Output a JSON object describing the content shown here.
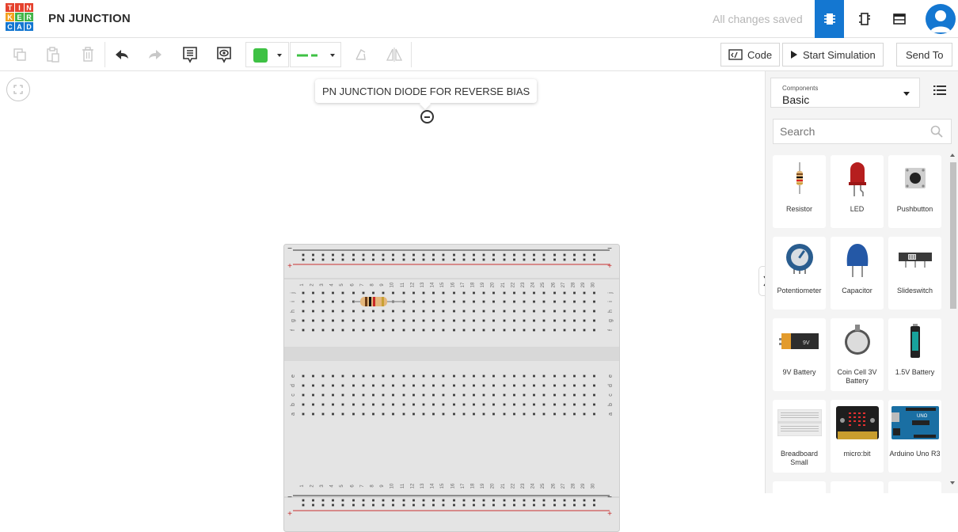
{
  "header": {
    "logo_letters": [
      "T",
      "I",
      "N",
      "K",
      "E",
      "R",
      "C",
      "A",
      "D"
    ],
    "title": "PN JUNCTION",
    "save_status": "All changes saved",
    "accent_color": "#1477d1"
  },
  "toolbar": {
    "color_swatch": "#3ec144",
    "code_label": "Code",
    "start_label": "Start Simulation",
    "send_label": "Send To"
  },
  "canvas": {
    "note_text": "PN JUNCTION DIODE FOR REVERSE BIAS",
    "breadboard": {
      "row_letters_top": [
        "j",
        "i",
        "h",
        "g",
        "f"
      ],
      "row_letters_bottom": [
        "e",
        "d",
        "c",
        "b",
        "a"
      ],
      "column_count": 30
    }
  },
  "panel": {
    "dropdown_caption": "Components",
    "dropdown_value": "Basic",
    "search_placeholder": "Search",
    "components": [
      {
        "label": "Resistor",
        "icon": "resistor-icon"
      },
      {
        "label": "LED",
        "icon": "led-icon"
      },
      {
        "label": "Pushbutton",
        "icon": "pushbutton-icon"
      },
      {
        "label": "Potentiometer",
        "icon": "potentiometer-icon"
      },
      {
        "label": "Capacitor",
        "icon": "capacitor-icon"
      },
      {
        "label": "Slideswitch",
        "icon": "slideswitch-icon"
      },
      {
        "label": "9V Battery",
        "icon": "battery-9v-icon"
      },
      {
        "label": "Coin Cell 3V Battery",
        "icon": "coin-cell-icon"
      },
      {
        "label": "1.5V Battery",
        "icon": "battery-15v-icon"
      },
      {
        "label": "Breadboard Small",
        "icon": "breadboard-small-icon"
      },
      {
        "label": "micro:bit",
        "icon": "microbit-icon"
      },
      {
        "label": "Arduino Uno R3",
        "icon": "arduino-icon"
      }
    ]
  }
}
